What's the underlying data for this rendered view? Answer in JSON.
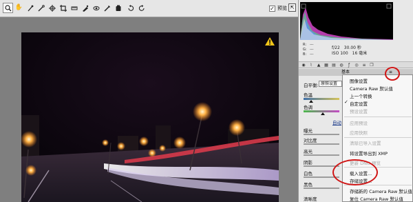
{
  "toolbar": {
    "tools": [
      "zoom-icon",
      "hand-icon",
      "white-balance-icon",
      "color-sampler-icon",
      "crop-icon",
      "straighten-icon",
      "retouch-icon",
      "red-eye-icon",
      "preferences-icon",
      "rotate-left-icon",
      "rotate-right-icon"
    ],
    "preview_label": "预览",
    "preview_checked": true
  },
  "histogram": {
    "readout": [
      {
        "k": "R:",
        "v": "---"
      },
      {
        "k": "G:",
        "v": "---"
      },
      {
        "k": "B:",
        "v": "---"
      }
    ],
    "camera": {
      "aperture": "f/22",
      "shutter": "30.00 秒",
      "iso": "ISO 100",
      "focal": "16 毫米"
    }
  },
  "panel": {
    "section_title": "基本",
    "section_menu": "≡",
    "white_balance_label": "白平衡:",
    "white_balance_value": "原照设置",
    "temp_label": "色温",
    "tint_label": "色调",
    "auto_label": "自动",
    "sliders": [
      "曝光",
      "对比度",
      "高光",
      "阴影",
      "白色",
      "黑色",
      "清晰度"
    ]
  },
  "menu": {
    "items": [
      {
        "label": "图像设置",
        "disabled": false,
        "checked": false
      },
      {
        "label": "Camera Raw 默认值",
        "disabled": false,
        "checked": false
      },
      {
        "label": "上一个转换",
        "disabled": false,
        "checked": false
      },
      {
        "label": "自定设置",
        "disabled": false,
        "checked": true
      },
      {
        "label": "预设设置",
        "disabled": true,
        "checked": false
      },
      {
        "label": "应用预设",
        "disabled": true,
        "checked": false
      },
      {
        "label": "应用快照",
        "disabled": true,
        "checked": false
      },
      {
        "label": "清除已导入设置",
        "disabled": true,
        "checked": false
      },
      {
        "label": "将设置导出到 XMP",
        "disabled": false,
        "checked": false
      },
      {
        "label": "更新 DNG 预览",
        "disabled": true,
        "checked": false
      },
      {
        "label": "载入设置...",
        "disabled": false,
        "checked": false
      },
      {
        "label": "存储设置...",
        "disabled": false,
        "checked": false
      },
      {
        "label": "存储新的 Camera Raw 默认值",
        "disabled": false,
        "checked": false
      },
      {
        "label": "复位 Camera Raw 默认值",
        "disabled": false,
        "checked": false
      }
    ]
  },
  "colors": {
    "highlight_circle": "#d01515",
    "histogram_bg": "#000000",
    "canvas_bg": "#7f7f7f"
  }
}
